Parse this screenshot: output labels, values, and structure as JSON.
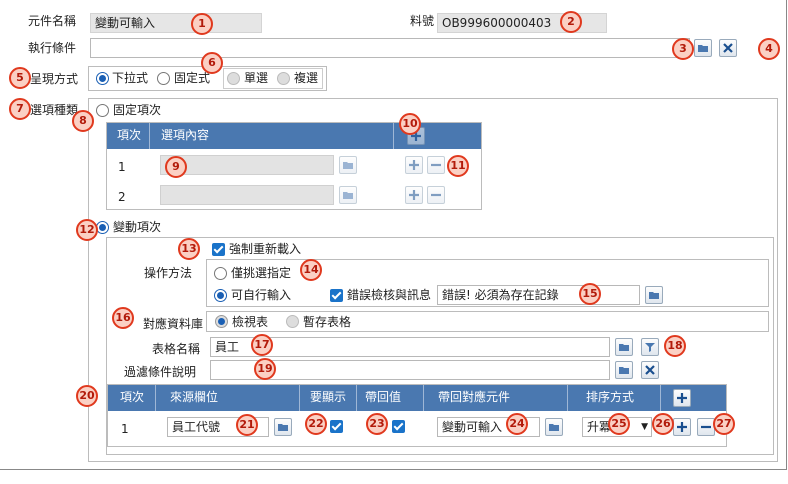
{
  "form": {
    "component_name_label": "元件名稱",
    "component_name_value": "變動可輸入",
    "part_no_label": "料號",
    "part_no_value": "OB999600000403",
    "exec_condition_label": "執行條件",
    "exec_condition_value": "",
    "present_label": "呈現方式",
    "present_options": [
      "下拉式",
      "固定式"
    ],
    "present_selected": "下拉式",
    "select_mode_options": [
      "單選",
      "複選"
    ],
    "option_type_label": "選項種類",
    "fixed_item_label": "固定項次",
    "variable_item_label": "變動項次"
  },
  "fixed_table": {
    "headers": [
      "項次",
      "選項內容"
    ],
    "rows": [
      {
        "index": "1",
        "content": ""
      },
      {
        "index": "2",
        "content": ""
      }
    ]
  },
  "variable": {
    "force_reload_label": "強制重新載入",
    "force_reload_checked": true,
    "op_method_label": "操作方法",
    "op_options": [
      "僅挑選指定",
      "可自行輸入"
    ],
    "op_selected": "可自行輸入",
    "error_check_label": "錯誤檢核與訊息",
    "error_check_checked": true,
    "error_message_value": "錯誤! 必須為存在記錄",
    "db_label": "對應資料庫",
    "db_options": [
      "檢視表",
      "暫存表格"
    ],
    "db_selected": "檢視表",
    "table_name_label": "表格名稱",
    "table_name_value": "員工",
    "filter_desc_label": "過濾條件說明",
    "filter_desc_value": ""
  },
  "mapping_table": {
    "headers": [
      "項次",
      "來源欄位",
      "要顯示",
      "帶回值",
      "帶回對應元件",
      "排序方式"
    ],
    "rows": [
      {
        "index": "1",
        "source": "員工代號",
        "show": true,
        "return": true,
        "target": "變動可輸入",
        "sort": "升冪"
      }
    ]
  },
  "annotations": [
    "1",
    "2",
    "3",
    "4",
    "5",
    "6",
    "7",
    "8",
    "9",
    "10",
    "11",
    "12",
    "13",
    "14",
    "15",
    "16",
    "17",
    "18",
    "19",
    "20",
    "21",
    "22",
    "23",
    "24",
    "25",
    "26",
    "27"
  ],
  "colors": {
    "header_bg": "#4a78b0",
    "accent": "#1a73c9",
    "annotation_border": "#e0391e",
    "annotation_fill": "#fbd0c4"
  }
}
